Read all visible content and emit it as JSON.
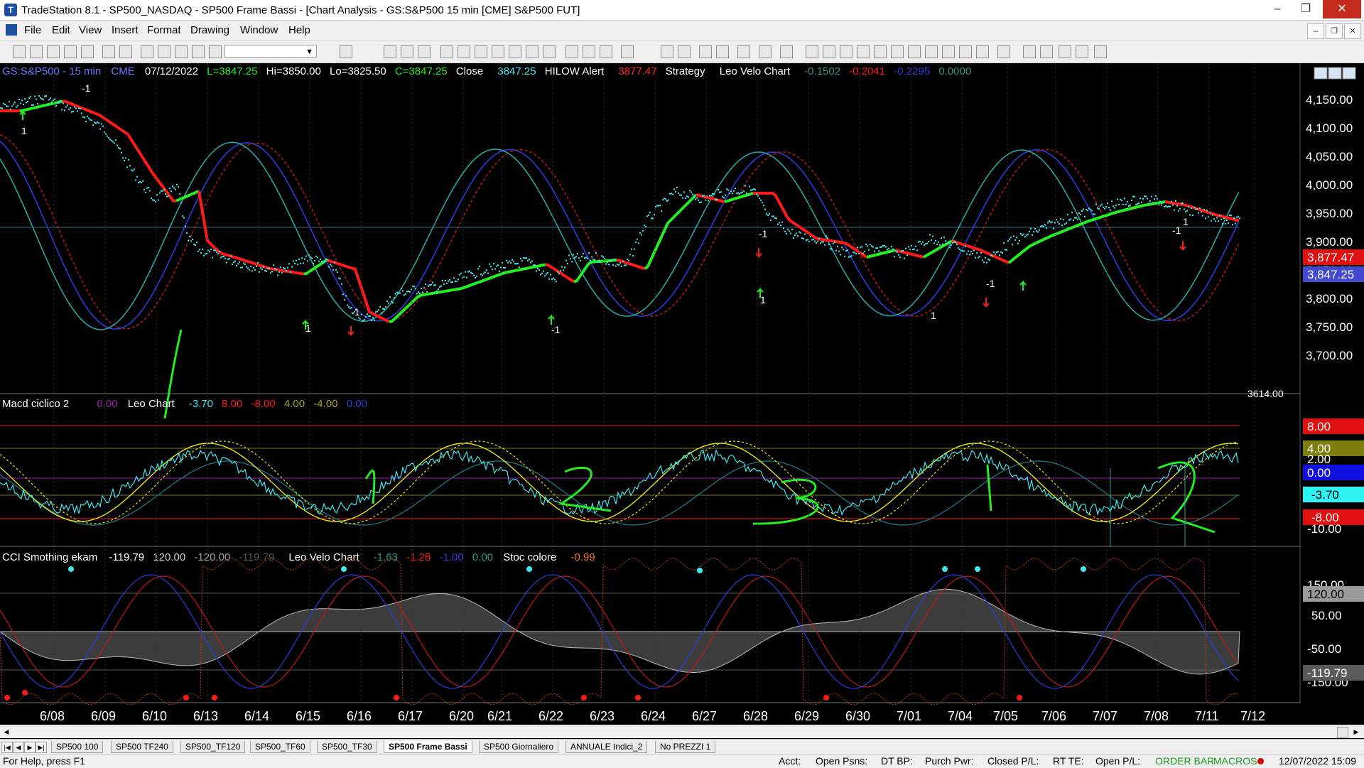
{
  "window": {
    "title": "TradeStation 8.1 - SP500_NASDAQ - SP500 Frame Bassi - [Chart Analysis - GS:S&P500  15 min  [CME] S&P500 FUT]",
    "minimize": "–",
    "maximize": "❐",
    "close": "✕"
  },
  "menu": {
    "items": [
      "File",
      "Edit",
      "View",
      "Insert",
      "Format",
      "Drawing",
      "Window",
      "Help"
    ],
    "doc_minimize": "–",
    "doc_restore": "❐",
    "doc_close": "✕"
  },
  "toolbar": {
    "combo_arrow": "▼"
  },
  "price_header": {
    "symbol": "GS:S&P500 - 15 min",
    "exchange": "CME",
    "date": "07/12/2022",
    "last": "L=3847.25",
    "high": "Hi=3850.00",
    "low": "Lo=3825.50",
    "close_eq": "C=3847.25",
    "close_label": "Close",
    "close_value": "3847.25",
    "hilow_label": "HILOW Alert",
    "hilow_value": "3877.47",
    "strategy": "Strategy",
    "leo": "Leo Velo Chart",
    "leo_v1": "-0.1502",
    "leo_v2": "-0.2041",
    "leo_v3": "-0.2295",
    "leo_v4": "0.0000"
  },
  "price_axis": {
    "ticks": [
      "4,150.00",
      "4,100.00",
      "4,050.00",
      "4,000.00",
      "3,950.00",
      "3,900.00",
      "3,850.00",
      "3,800.00",
      "3,750.00",
      "3,700.00"
    ],
    "marker_hilow": "3,877.47",
    "marker_close": "3,847.25",
    "partial_label": "3614.00"
  },
  "trade_markers": [
    "-1",
    "1",
    "-1",
    "1",
    "-1",
    "1",
    "-1",
    "1",
    "-1",
    "1",
    "-1"
  ],
  "macd_header": {
    "name": "Macd ciclico 2",
    "v0": "0.00",
    "leo": "Leo Chart",
    "v1": "-3.70",
    "v2": "8.00",
    "v3": "-8.00",
    "v4": "4.00",
    "v5": "-4.00",
    "v6": "0.00"
  },
  "macd_axis": {
    "m8": "8.00",
    "m4": "4.00",
    "m2": "2.00",
    "m0": "0.00",
    "mcur": "-3.70",
    "mn8": "-8.00",
    "mn10": "-10.00"
  },
  "cci_header": {
    "name": "CCI Smothing ekam",
    "v1": "-119.79",
    "v2": "120.00",
    "v3": "-120.00",
    "v4": "-119.79",
    "leo": "Leo Velo Chart",
    "l1": "-1.63",
    "l2": "-1.28",
    "l3": "-1.00",
    "l4": "0.00",
    "stoc": "Stoc colore",
    "stoc_v": "-0.99"
  },
  "cci_axis": {
    "c150": "150.00",
    "c120": "120.00",
    "c50": "50.00",
    "cn50": "-50.00",
    "cur": "-119.79",
    "cn150": "-150.00"
  },
  "date_axis": [
    "6/08",
    "6/09",
    "6/10",
    "6/13",
    "6/14",
    "6/15",
    "6/16",
    "6/17",
    "6/20",
    "6/21",
    "6/22",
    "6/23",
    "6/24",
    "6/27",
    "6/28",
    "6/29",
    "6/30",
    "7/01",
    "7/04",
    "7/05",
    "7/06",
    "7/07",
    "7/08",
    "7/11",
    "7/12"
  ],
  "annotations": [
    "1",
    "2",
    "3",
    "1",
    "2"
  ],
  "tabs": [
    "SP500 100",
    "SP500 TF240",
    "SP500_TF120",
    "SP500_TF60",
    "SP500_TF30",
    "SP500 Frame Bassi",
    "SP500 Giornaliero",
    "ANNUALE Indici_2",
    "No PREZZI 1"
  ],
  "tab_nav": [
    "|◀",
    "◀",
    "▶",
    "▶|"
  ],
  "status": {
    "help": "For Help, press F1",
    "acct": "Acct:",
    "open_psns": "Open Psns:",
    "dt_bp": "DT BP:",
    "purch_pwr": "Purch Pwr:",
    "closed_pl": "Closed P/L:",
    "rt_te": "RT TE:",
    "open_pl": "Open P/L:",
    "order_bar": "ORDER BAR",
    "macros": "MACROS",
    "datetime": "12/07/2022 15:09"
  },
  "colors": {
    "cyan": "#3fe8f0",
    "red": "#ff1a1a",
    "green": "#22ee22",
    "blue": "#2b3bd9",
    "yellow": "#e6e619",
    "grey_fill": "#6e6e6e",
    "axis_text": "#ffffff"
  }
}
